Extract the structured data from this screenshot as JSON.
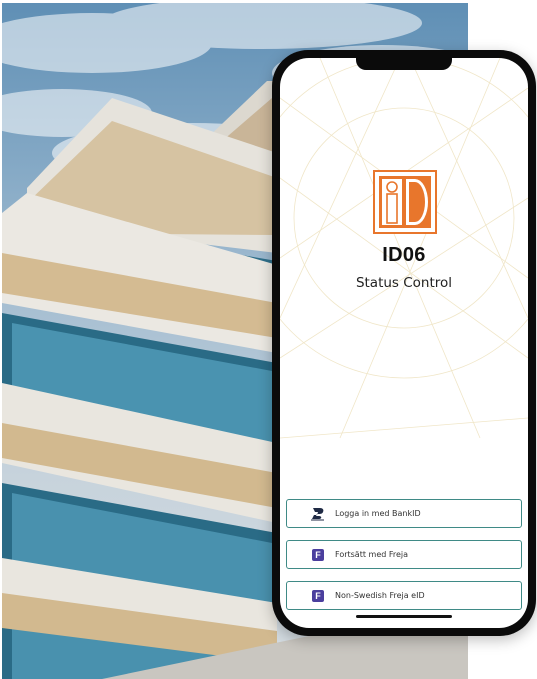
{
  "app": {
    "brand": "ID06",
    "subtitle": "Status Control"
  },
  "login_options": [
    {
      "label": "Logga in med BankID",
      "icon": "bankid-icon"
    },
    {
      "label": "Fortsätt med Freja",
      "icon": "freja-icon",
      "glyph": "F"
    },
    {
      "label": "Non-Swedish Freja eID",
      "icon": "freja-icon",
      "glyph": "F"
    }
  ],
  "colors": {
    "brand_orange": "#e8762c",
    "button_border": "#3f8a86",
    "freja_purple": "#4b3f9e"
  }
}
